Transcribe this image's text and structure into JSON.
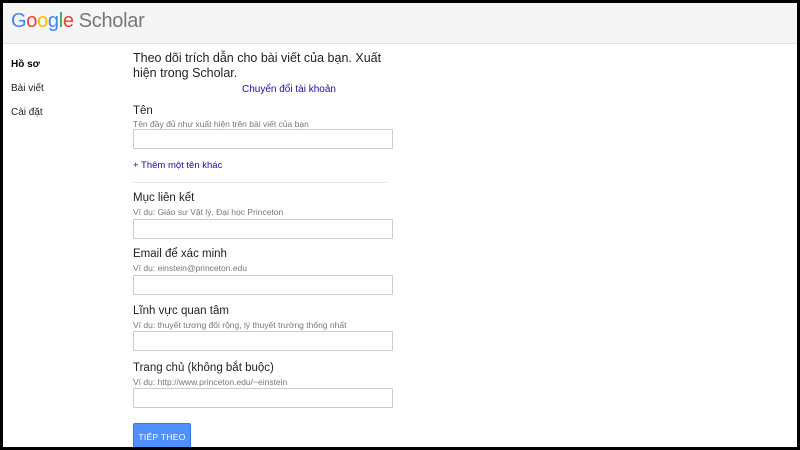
{
  "header": {
    "logo_google": [
      "G",
      "o",
      "o",
      "g",
      "l",
      "e"
    ],
    "logo_product": "Scholar"
  },
  "sidebar": {
    "items": [
      {
        "label": "Hồ sơ",
        "active": true
      },
      {
        "label": "Bài viết",
        "active": false
      },
      {
        "label": "Cài đặt",
        "active": false
      }
    ]
  },
  "main": {
    "intro": "Theo dõi trích dẫn cho bài viết của bạn. Xuất hiện trong Scholar.",
    "switch_account": "Chuyển đổi tài khoản",
    "name": {
      "label": "Tên",
      "hint": "Tên đầy đủ như xuất hiện trên bài viết của bạn",
      "value": ""
    },
    "add_name": "+ Thêm một tên khác",
    "affiliation": {
      "label": "Mục liên kết",
      "hint": "Ví dụ: Giáo sư Vật lý, Đại học Princeton",
      "value": ""
    },
    "email": {
      "label": "Email để xác minh",
      "hint": "Ví dụ: einstein@princeton.edu",
      "value": ""
    },
    "interests": {
      "label": "Lĩnh vực quan tâm",
      "hint": "Ví dụ: thuyết tương đối rộng, lý thuyết trường thống nhất",
      "value": ""
    },
    "homepage": {
      "label": "Trang chủ (không bắt buộc)",
      "hint": "Ví dụ: http://www.princeton.edu/~einstein",
      "value": ""
    },
    "next_button": "TIẾP THEO"
  }
}
